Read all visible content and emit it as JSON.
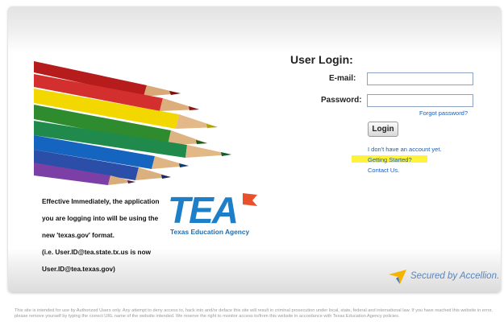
{
  "banner": {
    "notice_lines": [
      "Effective Immediately, the application",
      "you are logging into will be using the",
      "new 'texas.gov' format.",
      "(i.e. User.ID@tea.state.tx.us is now",
      "User.ID@tea.texas.gov)"
    ],
    "logo_text": "TEA",
    "logo_caption": "Texas Education Agency"
  },
  "login": {
    "title": "User Login:",
    "email_label": "E-mail:",
    "email_value": "",
    "password_label": "Password:",
    "password_value": "",
    "forgot_link": "Forgot password?",
    "login_button": "Login",
    "links": [
      "I don't have an account yet.",
      "Getting Started?",
      "Contact Us."
    ]
  },
  "secured": {
    "text": "Secured by Accellion."
  },
  "footer": {
    "text": "This site is intended for use by Authorized Users only. Any attempt to deny access to, hack into and/or deface this site will result in criminal prosecution under local, state, federal and international law. If you have reached this website in error, please remove yourself by typing the correct URL name of the website intended. We reserve the right to monitor access to/from this website in accordance with Texas Education Agency policies."
  },
  "colors": {
    "accent_blue": "#1d7fc7",
    "link_blue": "#1a5db8",
    "highlight": "#fff23a",
    "flag_red": "#e8512c"
  }
}
